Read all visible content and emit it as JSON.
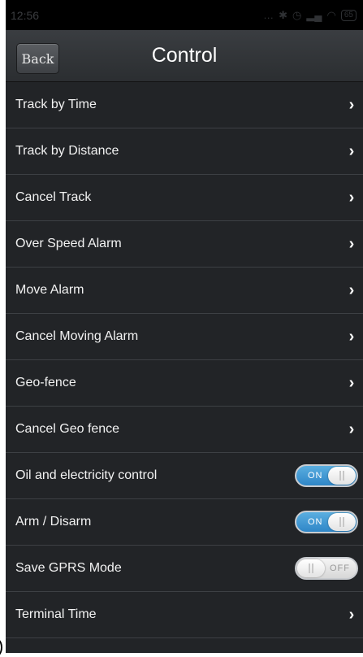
{
  "status_bar": {
    "time": "12:56",
    "icons": [
      "more-dots-icon",
      "bluetooth-icon",
      "alarm-icon",
      "signal-icon",
      "wifi-icon"
    ],
    "battery": "65"
  },
  "header": {
    "back_label": "Back",
    "title": "Control"
  },
  "items": [
    {
      "label": "Track by Time",
      "control": "chevron"
    },
    {
      "label": "Track by Distance",
      "control": "chevron"
    },
    {
      "label": "Cancel Track",
      "control": "chevron"
    },
    {
      "label": "Over Speed Alarm",
      "control": "chevron"
    },
    {
      "label": "Move Alarm",
      "control": "chevron"
    },
    {
      "label": "Cancel Moving Alarm",
      "control": "chevron"
    },
    {
      "label": "Geo-fence",
      "control": "chevron"
    },
    {
      "label": "Cancel Geo fence",
      "control": "chevron"
    },
    {
      "label": "Oil and electricity control",
      "control": "toggle",
      "state": "ON"
    },
    {
      "label": "Arm / Disarm",
      "control": "toggle",
      "state": "ON"
    },
    {
      "label": "Save GPRS Mode",
      "control": "toggle",
      "state": "OFF"
    },
    {
      "label": "Terminal Time",
      "control": "chevron"
    }
  ],
  "chevron_glyph": "›",
  "colors": {
    "background": "#222427",
    "toggle_on": "#2f86c7",
    "divider": "#3d4044"
  }
}
